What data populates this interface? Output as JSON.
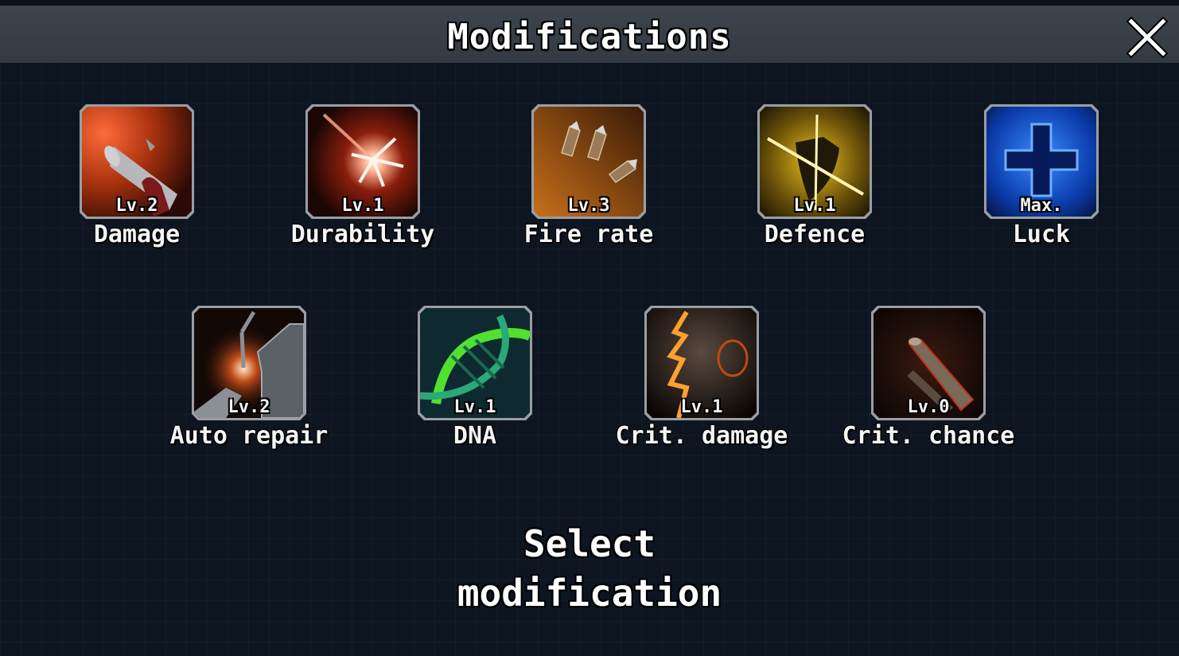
{
  "header": {
    "title": "Modifications",
    "close_icon": "close-x-icon"
  },
  "modifications": [
    {
      "name": "Damage",
      "level": "Lv.2",
      "icon": "pistol-barrel-icon",
      "theme": "#c0401a"
    },
    {
      "name": "Durability",
      "level": "Lv.1",
      "icon": "impact-burst-icon",
      "theme": "#a02810"
    },
    {
      "name": "Fire rate",
      "level": "Lv.3",
      "icon": "bullets-icon",
      "theme": "#b0601a"
    },
    {
      "name": "Defence",
      "level": "Lv.1",
      "icon": "shield-slash-icon",
      "theme": "#b08a10"
    },
    {
      "name": "Luck",
      "level": "Max.",
      "icon": "blue-cross-icon",
      "theme": "#1a5ad8"
    },
    {
      "name": "Auto repair",
      "level": "Lv.2",
      "icon": "welding-repair-icon",
      "theme": "#8a3a18"
    },
    {
      "name": "DNA",
      "level": "Lv.1",
      "icon": "dna-helix-icon",
      "theme": "#2aa040"
    },
    {
      "name": "Crit. damage",
      "level": "Lv.1",
      "icon": "saw-blade-icon",
      "theme": "#d07010"
    },
    {
      "name": "Crit. chance",
      "level": "Lv.0",
      "icon": "silencer-icon",
      "theme": "#5a2010"
    }
  ],
  "prompt": {
    "line1": "Select",
    "line2": "modification"
  }
}
